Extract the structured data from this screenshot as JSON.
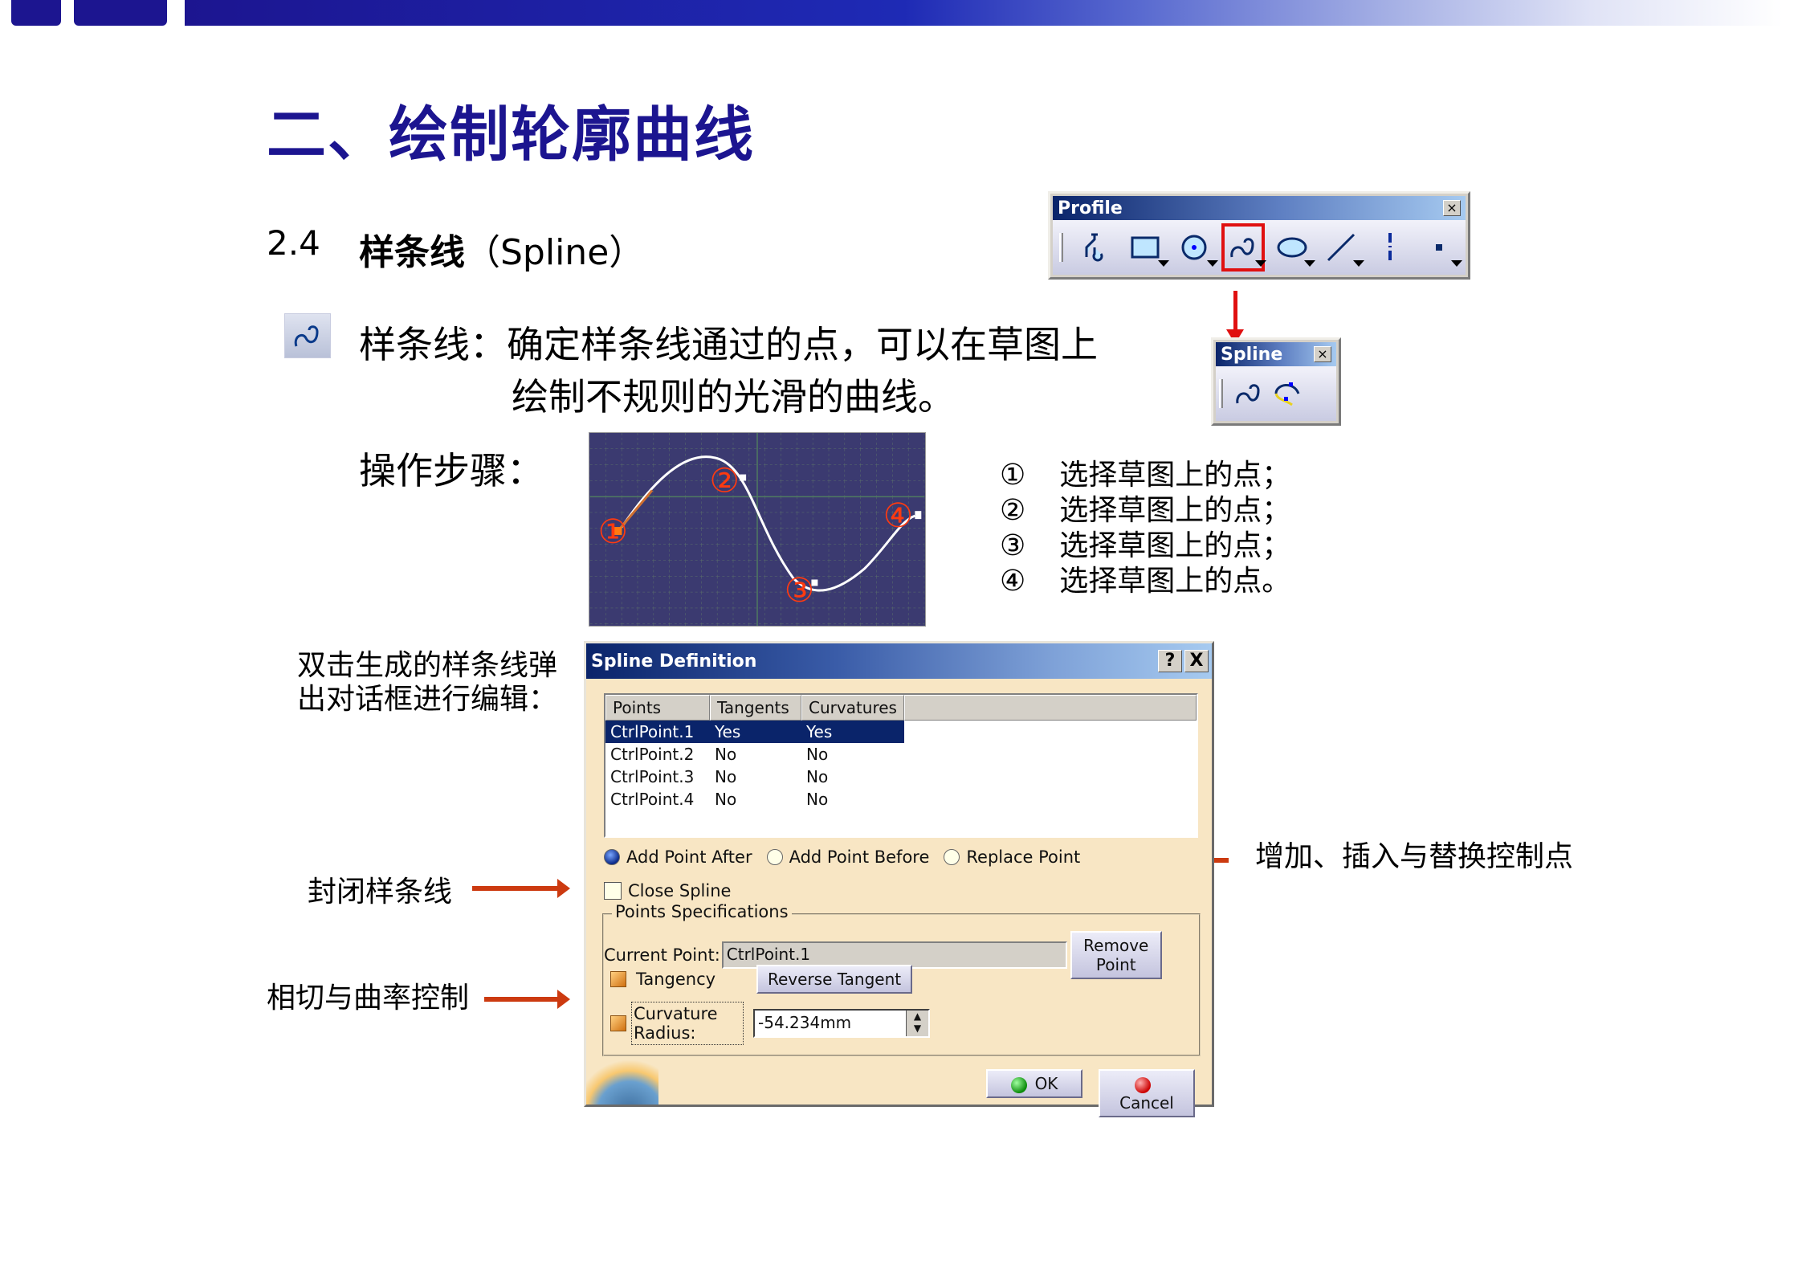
{
  "slide": {
    "title": "二、绘制轮廓曲线",
    "section_number": "2.4",
    "section_title": "样条线",
    "section_title_en": "（Spline）",
    "description_line1": "样条线：确定样条线通过的点，可以在草图上",
    "description_line2": "绘制不规则的光滑的曲线。",
    "steps_label": "操作步骤：",
    "steps": [
      {
        "marker": "①",
        "text": "选择草图上的点；"
      },
      {
        "marker": "②",
        "text": "选择草图上的点；"
      },
      {
        "marker": "③",
        "text": "选择草图上的点；"
      },
      {
        "marker": "④",
        "text": "选择草图上的点。"
      }
    ],
    "canvas_markers": [
      "①",
      "②",
      "③",
      "④"
    ],
    "dialog_note_line1": "双击生成的样条线弹",
    "dialog_note_line2": "出对话框进行编辑：",
    "annotation_close": "封闭样条线",
    "annotation_tangent": "相切与曲率控制",
    "annotation_points": "增加、插入与替换控制点",
    "colors": {
      "brand": "#1c1590",
      "arrow": "#cc3a10",
      "highlight": "#e01010"
    }
  },
  "profile_toolbar": {
    "title": "Profile",
    "close": "×",
    "tools": [
      "profile-icon",
      "rectangle-icon",
      "circle-icon",
      "spline-icon",
      "ellipse-icon",
      "line-icon",
      "axis-icon",
      "point-icon"
    ],
    "selected": "spline-icon"
  },
  "spline_toolbar": {
    "title": "Spline",
    "close": "×",
    "tools": [
      "spline-icon",
      "connect-icon"
    ]
  },
  "dialog": {
    "title": "Spline Definition",
    "help": "?",
    "close": "X",
    "columns": [
      "Points",
      "Tangents",
      "Curvatures"
    ],
    "rows": [
      {
        "point": "CtrlPoint.1",
        "tangent": "Yes",
        "curvature": "Yes",
        "selected": true
      },
      {
        "point": "CtrlPoint.2",
        "tangent": "No",
        "curvature": "No"
      },
      {
        "point": "CtrlPoint.3",
        "tangent": "No",
        "curvature": "No"
      },
      {
        "point": "CtrlPoint.4",
        "tangent": "No",
        "curvature": "No"
      }
    ],
    "radio_options": [
      "Add Point After",
      "Add Point Before",
      "Replace Point"
    ],
    "radio_selected": "Add Point After",
    "close_spline_label": "Close Spline",
    "close_spline_checked": false,
    "group_label": "Points Specifications",
    "current_point_label": "Current Point:",
    "current_point_value": "CtrlPoint.1",
    "remove_point_label": "Remove Point",
    "tangency_label": "Tangency",
    "tangency_checked": true,
    "reverse_tangent_label": "Reverse Tangent",
    "curvature_label": "Curvature Radius:",
    "curvature_checked": true,
    "curvature_value": "-54.234mm",
    "ok_label": "OK",
    "cancel_label": "Cancel"
  }
}
